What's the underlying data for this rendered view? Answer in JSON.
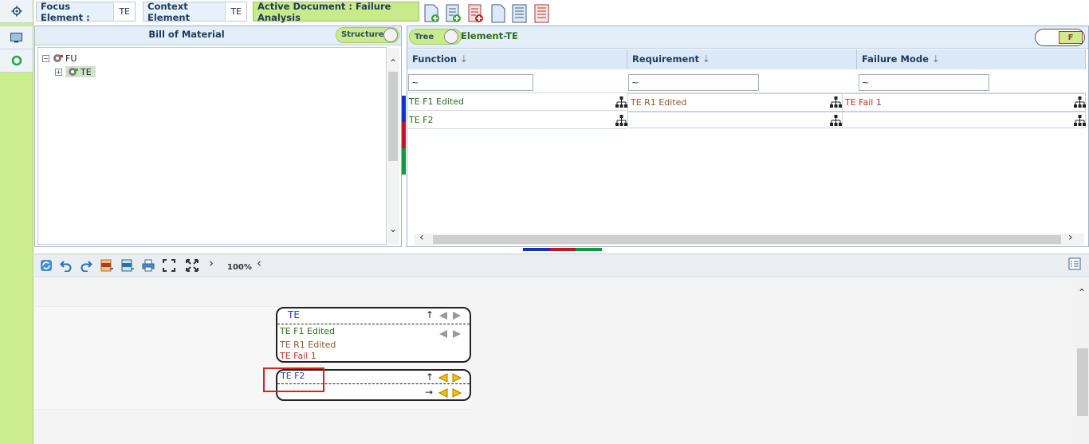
{
  "toolbar": {
    "focus_label": "Focus Element :",
    "focus_value": "TE",
    "context_label": "Context Element",
    "context_value": "TE",
    "active_doc": "Active Document : Failure Analysis"
  },
  "bom": {
    "title": "Bill of Material",
    "toggle_label": "Structure",
    "tree": [
      {
        "label": "FU",
        "sign": "⊟"
      },
      {
        "label": "TE",
        "sign": "⊞"
      }
    ]
  },
  "grid": {
    "toggle_tree": "Tree",
    "toggle_element": "Element-TE",
    "badge": "F",
    "columns": [
      "Function",
      "Requirement",
      "Failure Mode"
    ],
    "filter": [
      "~",
      "~",
      "~"
    ],
    "rows": [
      {
        "function": "TE F1 Edited",
        "requirement": "TE R1 Edited",
        "failure": "TE Fail 1"
      },
      {
        "function": "TE F2",
        "requirement": "",
        "failure": ""
      }
    ]
  },
  "diagram": {
    "zoom": "100%",
    "node1": {
      "title": "TE",
      "func": "TE F1 Edited",
      "req": "TE R1 Edited",
      "fail": "TE Fail 1"
    },
    "node2": {
      "title": "TE F2"
    }
  },
  "colors": {
    "rail": "#cbec8f",
    "function_text": "#2e6b1f",
    "requirement_text": "#8a5a2b",
    "failure_text": "#c0302a",
    "title_blue": "#2b3fbf"
  }
}
